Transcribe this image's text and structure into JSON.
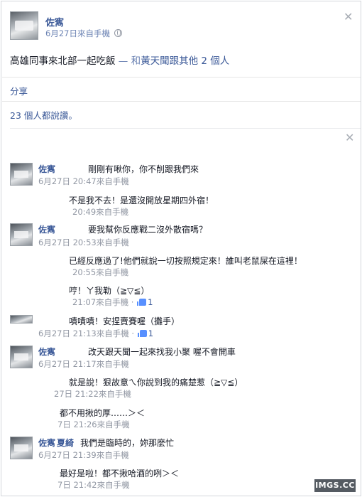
{
  "post": {
    "author": "佐寯",
    "meta": "6月27日來自手機",
    "text_main": "高雄同事來北部一起吃飯",
    "text_with": "— 和",
    "text_tag": "黃天聞",
    "text_and": "跟其他 2 個人",
    "share_label": "分享",
    "likes_text": "23 個人都說讚。"
  },
  "comments": [
    {
      "name": "佐寯",
      "text": "剛剛有啾你，你不削跟我們來",
      "meta": "6月27日 20:47來自手機"
    },
    {
      "name": "",
      "text": "不是我不去！是還沒開放星期四外宿！",
      "meta": "20:49來自手機"
    },
    {
      "name": "佐寯",
      "text": "要我幫你反應戰二沒外散宿嗎？",
      "meta": "6月27日 20:53來自手機"
    },
    {
      "name": "",
      "text": "已經反應過了!他們就說一切按照規定來！誰叫老鼠屎在這裡！",
      "meta": "20:55來自手機"
    },
    {
      "name": "",
      "text": "哼！ㄚ我勒（≧▽≦）",
      "meta": "21:07來自手機 · ",
      "likes": "1"
    },
    {
      "name": "",
      "text": "嘖嘖嘖！安捏賣賽喔（攤手）",
      "meta": "6月27日 21:13來自手機 · ",
      "likes": "1"
    },
    {
      "name": "佐寯",
      "text": "改天跟天聞一起來找我小聚 喔不會開車",
      "meta": "6月27日 21:17來自手機"
    },
    {
      "name": "",
      "text": "就是說！狠故意ㄟ你說到我的痛楚惹（≧▽≦）",
      "meta": "27日 21:22來自手機"
    },
    {
      "name": "",
      "text": "都不用揪的厚……＞＜",
      "meta": "7日 21:26來自手機"
    },
    {
      "name": "佐寯",
      "name2": "夏綺",
      "text": "我們是臨時的，妳那麼忙",
      "meta": "6月27日 21:39來自手機"
    },
    {
      "name": "",
      "text": "最好是啦！都不揪哈酒的咧＞＜",
      "meta": "7日 21:42來自手機"
    }
  ],
  "watermark": "IMGS.CC",
  "icons": {
    "close": "close-icon",
    "globe": "globe-icon",
    "like": "thumbs-up-icon"
  },
  "colors": {
    "link": "#3b5998",
    "meta": "#9197a3",
    "text": "#141823"
  }
}
